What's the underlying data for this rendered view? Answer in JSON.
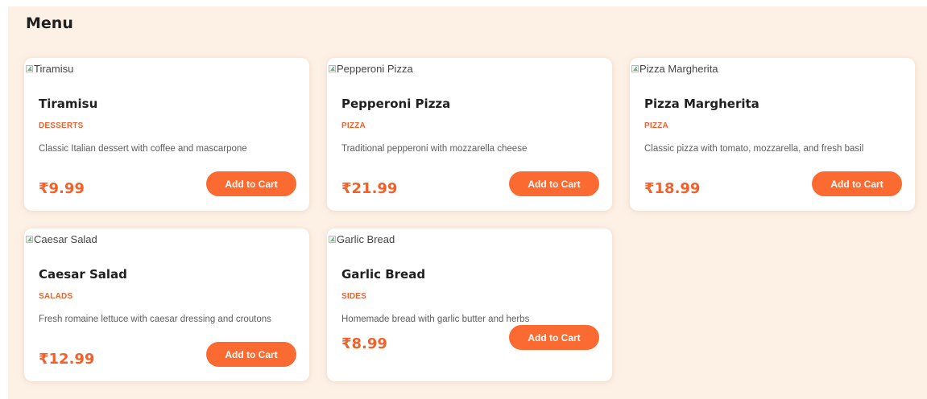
{
  "menu": {
    "title": "Menu"
  },
  "items": [
    {
      "image_alt": "Tiramisu",
      "name": "Tiramisu",
      "category": "DESSERTS",
      "description": "Classic Italian dessert with coffee and mascarpone",
      "price": "₹9.99",
      "button_label": "Add to Cart"
    },
    {
      "image_alt": "Pepperoni Pizza",
      "name": "Pepperoni Pizza",
      "category": "PIZZA",
      "description": "Traditional pepperoni with mozzarella cheese",
      "price": "₹21.99",
      "button_label": "Add to Cart"
    },
    {
      "image_alt": "Pizza Margherita",
      "name": "Pizza Margherita",
      "category": "PIZZA",
      "description": "Classic pizza with tomato, mozzarella, and fresh basil",
      "price": "₹18.99",
      "button_label": "Add to Cart"
    },
    {
      "image_alt": "Caesar Salad",
      "name": "Caesar Salad",
      "category": "SALADS",
      "description": "Fresh romaine lettuce with caesar dressing and croutons",
      "price": "₹12.99",
      "button_label": "Add to Cart"
    },
    {
      "image_alt": "Garlic Bread",
      "name": "Garlic Bread",
      "category": "SIDES",
      "description": "Homemade bread with garlic butter and herbs",
      "price": "₹8.99",
      "button_label": "Add to Cart"
    }
  ],
  "icons": {
    "broken_image": "broken-image-icon"
  },
  "colors": {
    "page_background": "#fdf1e6",
    "card_background": "#ffffff",
    "accent": "#f0612c",
    "button": "#fb6a30",
    "title_text": "#1f1f1f",
    "body_text": "#5d5d5d"
  }
}
